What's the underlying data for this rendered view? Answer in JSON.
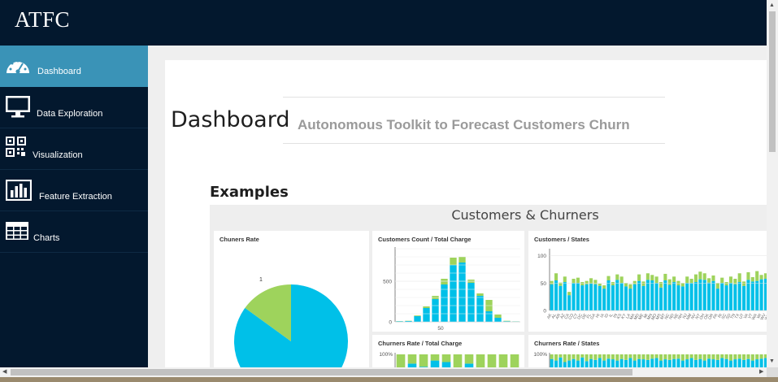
{
  "header": {
    "logo": "ATFC"
  },
  "sidebar": {
    "items": [
      {
        "label": "Dashboard",
        "icon": "dashboard-gauge-icon",
        "active": true
      },
      {
        "label": "Data Exploration",
        "icon": "monitor-icon",
        "active": false
      },
      {
        "label": "Visualization",
        "icon": "qr-code-icon",
        "active": false
      },
      {
        "label": "Feature Extraction",
        "icon": "bar-chart-icon",
        "active": false
      },
      {
        "label": "Charts",
        "icon": "table-grid-icon",
        "active": false
      }
    ]
  },
  "main": {
    "title": "Dashboard",
    "subtitle": "Autonomous Toolkit to Forecast Customers Churn",
    "section_heading": "Examples",
    "dashboard_title": "Customers & Churners"
  },
  "colors": {
    "navy": "#03182e",
    "active_teal": "#3a93b7",
    "customers_blue": "#00c0e8",
    "churners_green": "#9ed35c"
  },
  "chart_data": [
    {
      "type": "pie",
      "title": "Chuners Rate",
      "labels": [
        "1"
      ],
      "slices": [
        {
          "category": "0",
          "fraction": 0.85,
          "color": "#00c0e8"
        },
        {
          "category": "1",
          "fraction": 0.15,
          "color": "#9ed35c"
        }
      ]
    },
    {
      "type": "bar",
      "title": "Customers Count / Total Charge",
      "stacked": true,
      "yticks": [
        0,
        500
      ],
      "xticks": [
        "50"
      ],
      "ylim": [
        0,
        900
      ],
      "series": [
        {
          "color": "#00c0e8",
          "values": [
            8,
            10,
            70,
            170,
            280,
            460,
            700,
            730,
            480,
            320,
            130,
            50,
            8,
            4
          ]
        },
        {
          "color": "#9ed35c",
          "values": [
            2,
            3,
            8,
            20,
            40,
            70,
            90,
            70,
            40,
            30,
            140,
            40,
            5,
            2
          ]
        }
      ]
    },
    {
      "type": "bar",
      "title": "Customers / States",
      "stacked": true,
      "yticks": [
        0,
        50,
        100
      ],
      "ylim": [
        0,
        110
      ],
      "categories": [
        "AK",
        "AL",
        "AR",
        "AZ",
        "CA",
        "CO",
        "CT",
        "DC",
        "DE",
        "FL",
        "GA",
        "HI",
        "IA",
        "ID",
        "IL",
        "IN",
        "KS",
        "KY",
        "LA",
        "MA",
        "MD",
        "ME",
        "MI",
        "MN",
        "MO",
        "MS",
        "MT",
        "NC",
        "ND",
        "NE",
        "NH",
        "NJ",
        "NM",
        "NV",
        "NY",
        "OH",
        "OK",
        "OR",
        "PA",
        "RI",
        "SC",
        "SD",
        "TN",
        "TX",
        "UT",
        "VA",
        "VT",
        "WA",
        "WI",
        "WV",
        "WY"
      ],
      "series": [
        {
          "color": "#00c0e8",
          "values": [
            48,
            55,
            45,
            52,
            28,
            50,
            50,
            46,
            48,
            49,
            48,
            45,
            40,
            55,
            46,
            56,
            50,
            44,
            40,
            48,
            54,
            45,
            56,
            55,
            50,
            42,
            55,
            47,
            52,
            46,
            44,
            50,
            50,
            52,
            57,
            56,
            51,
            54,
            40,
            50,
            46,
            50,
            48,
            52,
            45,
            56,
            53,
            54,
            57,
            58,
            47
          ]
        },
        {
          "color": "#9ed35c",
          "values": [
            6,
            13,
            6,
            10,
            6,
            8,
            10,
            6,
            6,
            10,
            8,
            4,
            6,
            8,
            6,
            10,
            12,
            6,
            8,
            6,
            12,
            8,
            12,
            10,
            12,
            10,
            12,
            10,
            10,
            8,
            6,
            12,
            8,
            14,
            14,
            12,
            8,
            10,
            10,
            10,
            6,
            12,
            10,
            16,
            8,
            14,
            8,
            18,
            8,
            10,
            8
          ]
        }
      ]
    },
    {
      "type": "bar",
      "title": "Churners Rate / Total Charge",
      "stacked": true,
      "yticks": [
        "100%"
      ],
      "series": [
        {
          "color": "#00c0e8",
          "values": [
            0.5,
            0.7,
            0.6,
            0.8,
            0.75,
            0.5,
            0.7,
            0.0,
            0.0,
            0.0,
            0.0
          ]
        },
        {
          "color": "#9ed35c",
          "values": [
            0.5,
            0.3,
            0.4,
            0.2,
            0.25,
            0.5,
            0.3,
            1.0,
            1.0,
            1.0,
            1.0
          ]
        }
      ]
    },
    {
      "type": "bar",
      "title": "Churners Rate / States",
      "stacked": true,
      "yticks": [
        "100%"
      ],
      "series": [
        {
          "color": "#00c0e8",
          "values": [
            0.85,
            0.8,
            0.9,
            0.75,
            0.8,
            0.85,
            0.8,
            0.9,
            0.78,
            0.85,
            0.82,
            0.88,
            0.8,
            0.86,
            0.84,
            0.8,
            0.85,
            0.82,
            0.88,
            0.8,
            0.85,
            0.84,
            0.82,
            0.86,
            0.88,
            0.8,
            0.84,
            0.82,
            0.85,
            0.86,
            0.8,
            0.84,
            0.88,
            0.82,
            0.85,
            0.8,
            0.86,
            0.84,
            0.82,
            0.88,
            0.85,
            0.8,
            0.84,
            0.86,
            0.82,
            0.85,
            0.8,
            0.84,
            0.86,
            0.88,
            0.82
          ]
        },
        {
          "color": "#9ed35c",
          "values": [
            0.15,
            0.2,
            0.1,
            0.25,
            0.2,
            0.15,
            0.2,
            0.1,
            0.22,
            0.15,
            0.18,
            0.12,
            0.2,
            0.14,
            0.16,
            0.2,
            0.15,
            0.18,
            0.12,
            0.2,
            0.15,
            0.16,
            0.18,
            0.14,
            0.12,
            0.2,
            0.16,
            0.18,
            0.15,
            0.14,
            0.2,
            0.16,
            0.12,
            0.18,
            0.15,
            0.2,
            0.14,
            0.16,
            0.18,
            0.12,
            0.15,
            0.2,
            0.16,
            0.14,
            0.18,
            0.15,
            0.2,
            0.16,
            0.14,
            0.12,
            0.18
          ]
        }
      ]
    }
  ]
}
